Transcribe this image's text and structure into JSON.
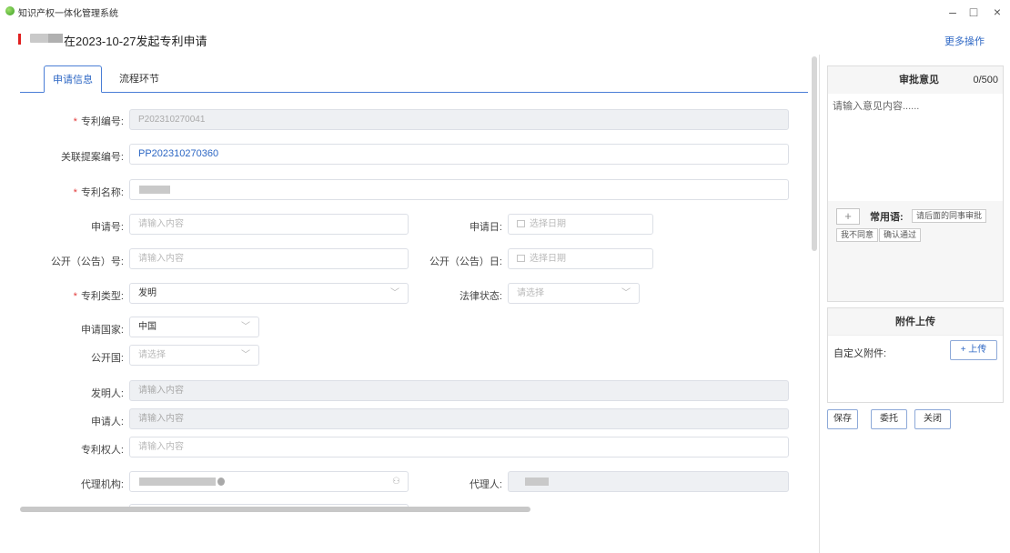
{
  "window": {
    "title": "知识产权一体化管理系统",
    "minimize": "–",
    "maximize": "□",
    "close": "×"
  },
  "header": {
    "title": "在2023-10-27发起专利申请",
    "more_ops": "更多操作",
    "accent": "#e02020"
  },
  "tabs": [
    {
      "label": "申请信息",
      "active": true
    },
    {
      "label": "流程环节",
      "active": false
    }
  ],
  "form": {
    "patent_no": {
      "label": "专利编号:",
      "value": "P202310270041"
    },
    "related_case_no": {
      "label": "关联提案编号:",
      "value": "PP202310270360"
    },
    "patent_name": {
      "label": "专利名称:"
    },
    "app_no": {
      "label": "申请号:",
      "placeholder": "请输入内容"
    },
    "app_date": {
      "label": "申请日:",
      "placeholder": "选择日期"
    },
    "pub_no": {
      "label": "公开（公告）号:",
      "placeholder": "请输入内容"
    },
    "pub_date": {
      "label": "公开（公告）日:",
      "placeholder": "选择日期"
    },
    "patent_type": {
      "label": "专利类型:",
      "value": "发明"
    },
    "legal_status": {
      "label": "法律状态:",
      "placeholder": "请选择"
    },
    "app_country": {
      "label": "申请国家:",
      "value": "中国"
    },
    "pub_country": {
      "label": "公开国:",
      "placeholder": "请选择"
    },
    "inventor": {
      "label": "发明人:",
      "placeholder": "请输入内容"
    },
    "applicant": {
      "label": "申请人:",
      "placeholder": "请输入内容"
    },
    "patentee": {
      "label": "专利权人:",
      "placeholder": "请输入内容"
    },
    "agency": {
      "label": "代理机构:"
    },
    "agent": {
      "label": "代理人:"
    }
  },
  "approval": {
    "title": "审批意见",
    "count": "0/500",
    "placeholder": "请输入意见内容......",
    "add": "+",
    "common_label": "常用语:",
    "chips": [
      "请后面的同事审批",
      "我不同意",
      "确认通过"
    ]
  },
  "attachment": {
    "title": "附件上传",
    "label": "自定义附件:",
    "upload": "+ 上传"
  },
  "actions": {
    "save": "保存",
    "delegate": "委托",
    "close": "关闭"
  }
}
